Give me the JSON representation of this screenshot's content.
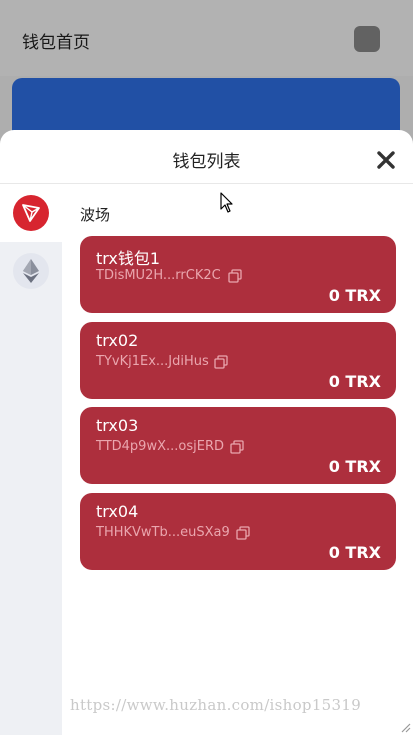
{
  "background": {
    "title": "钱包首页"
  },
  "modal": {
    "title": "钱包列表",
    "chains": [
      {
        "name": "TRON",
        "icon": "tron-icon",
        "active": true
      },
      {
        "name": "Ethereum",
        "icon": "ethereum-icon",
        "active": false
      }
    ],
    "section_label": "波场",
    "wallets": [
      {
        "name": "trx钱包1",
        "address": "TDisMU2H...rrCK2C",
        "balance": "0 TRX"
      },
      {
        "name": "trx02",
        "address": "TYvKj1Ex...JdiHus",
        "balance": "0 TRX"
      },
      {
        "name": "trx03",
        "address": "TTD4p9wX...osjERD",
        "balance": "0 TRX"
      },
      {
        "name": "trx04",
        "address": "THHKVwTb...euSXa9",
        "balance": "0 TRX"
      }
    ]
  },
  "watermark": "https://www.huzhan.com/ishop15319",
  "colors": {
    "card": "#ad2f3d",
    "tron_red": "#d7252f",
    "overlay_banner": "#2f6fe5",
    "rail": "#eef0f4"
  }
}
